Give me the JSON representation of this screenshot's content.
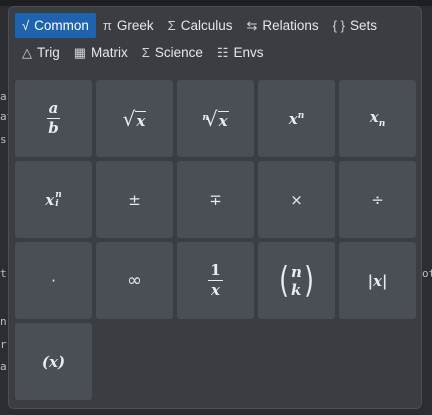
{
  "tabs_row1": [
    {
      "icon": "√",
      "icon_name": "sqrt-icon",
      "label": "Common",
      "active": true
    },
    {
      "icon": "π",
      "icon_name": "pi-icon",
      "label": "Greek"
    },
    {
      "icon": "Σ",
      "icon_name": "sigma-icon",
      "label": "Calculus"
    },
    {
      "icon": "⇆",
      "icon_name": "arrows-icon",
      "label": "Relations"
    },
    {
      "icon": "{ }",
      "icon_name": "braces-icon",
      "label": "Sets"
    }
  ],
  "tabs_row2": [
    {
      "icon": "△",
      "icon_name": "triangle-icon",
      "label": "Trig"
    },
    {
      "icon": "▦",
      "icon_name": "grid-icon",
      "label": "Matrix"
    },
    {
      "icon": "Σ",
      "icon_name": "sigma-icon",
      "label": "Science"
    },
    {
      "icon": "☷",
      "icon_name": "list-icon",
      "label": "Envs"
    }
  ],
  "symbols": {
    "frac_num": "a",
    "frac_den": "b",
    "sqrt_arg": "x",
    "nroot_idx": "n",
    "nroot_arg": "x",
    "pow_base": "x",
    "pow_exp": "n",
    "sub_base": "x",
    "sub_idx": "n",
    "subsup_base": "x",
    "subsup_sup": "n",
    "subsup_sub": "i",
    "plusminus": "±",
    "minusplus": "∓",
    "times": "×",
    "divide": "÷",
    "cdot": "·",
    "infinity": "∞",
    "inv_num": "1",
    "inv_den": "x",
    "binom_top": "n",
    "binom_bot": "k",
    "abs": "|x|",
    "paren": "(x)"
  },
  "background_fragments": [
    "ar",
    "at",
    "s",
    "t",
    "n",
    "r",
    "ar",
    "ot"
  ]
}
